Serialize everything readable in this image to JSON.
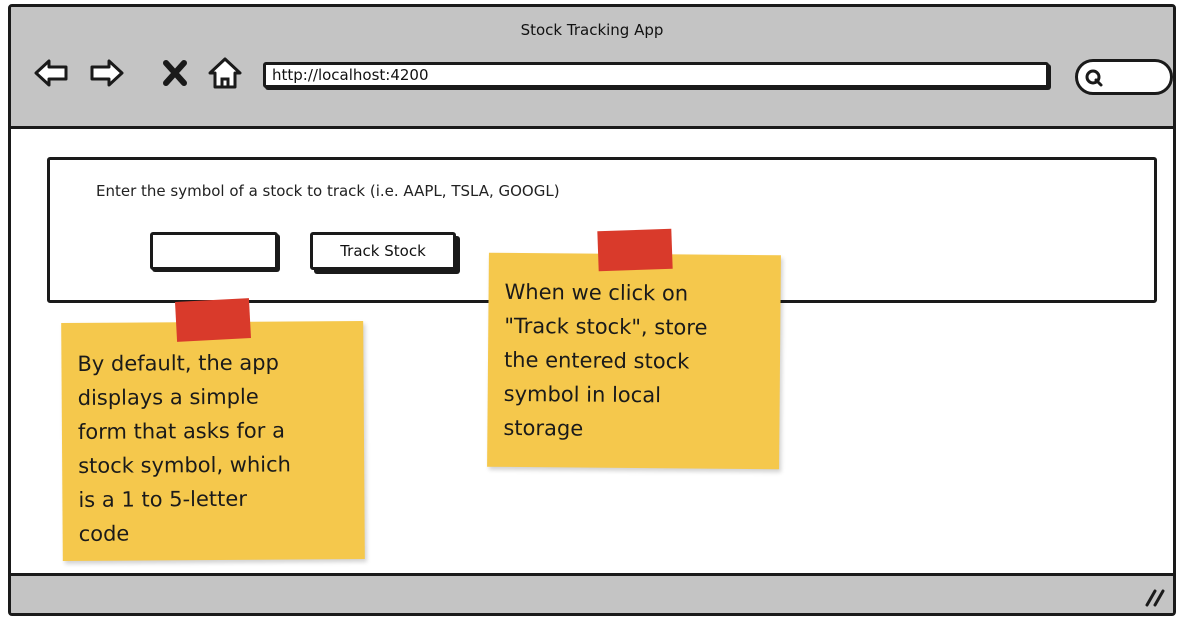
{
  "window": {
    "title": "Stock Tracking App",
    "url": "http://localhost:4200"
  },
  "toolbar": {
    "icons": [
      "back-arrow-icon",
      "forward-arrow-icon",
      "close-x-icon",
      "home-icon",
      "search-icon"
    ]
  },
  "form": {
    "prompt": "Enter the symbol of a stock to track (i.e. AAPL, TSLA, GOOGL)",
    "symbol_value": "",
    "track_button_label": "Track Stock"
  },
  "notes": {
    "left": "By default, the app\ndisplays a simple\nform that asks for a\nstock symbol, which\nis a 1 to 5-letter\ncode",
    "right": "When we click on\n\"Track stock\", store\nthe entered stock\nsymbol in local\nstorage"
  },
  "colors": {
    "chrome": "#c4c4c4",
    "note": "#f5c84c",
    "tape": "#d93a2b",
    "outline": "#1a1a1a"
  }
}
